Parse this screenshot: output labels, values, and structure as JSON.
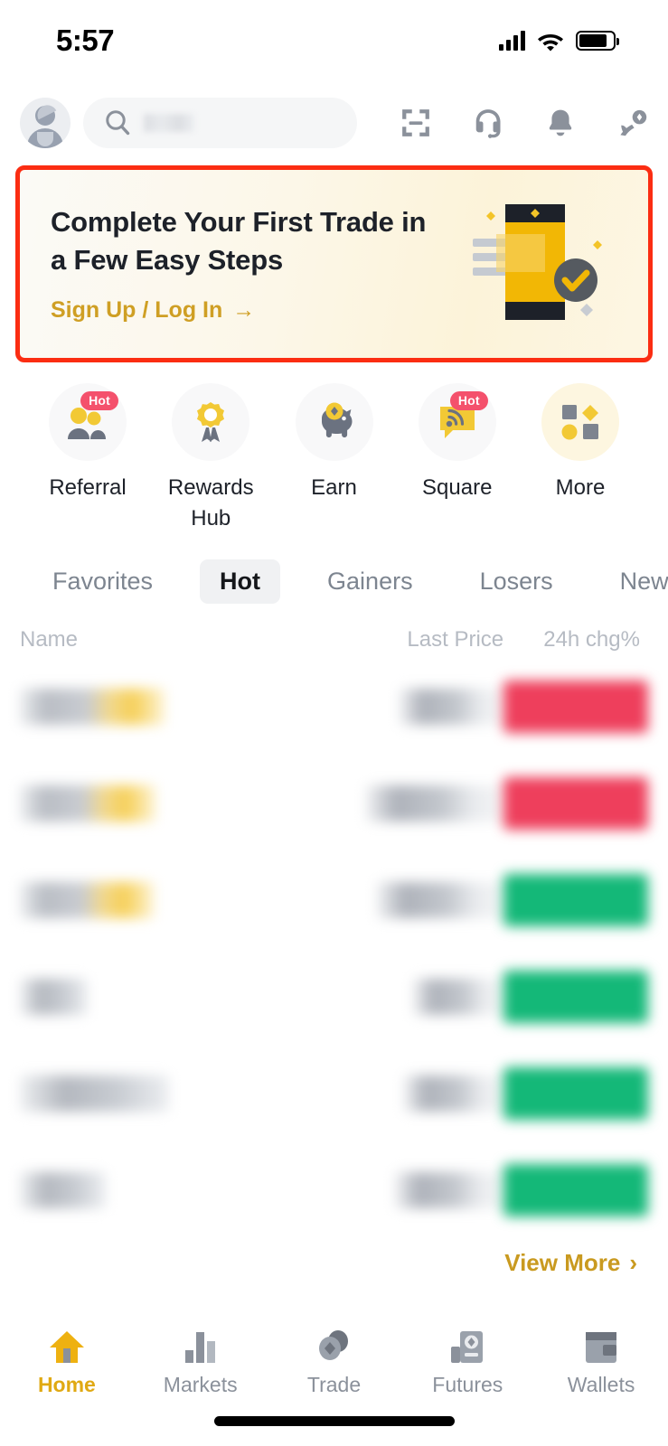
{
  "status_bar": {
    "time": "5:57",
    "signal_icon": "signal-bars-icon",
    "wifi_icon": "wifi-icon",
    "battery_icon": "battery-icon"
  },
  "header": {
    "avatar": "user-avatar",
    "search": {
      "placeholder": "",
      "icon": "search-icon"
    },
    "icons": [
      {
        "name": "qr-scan-icon",
        "label": "Scan"
      },
      {
        "name": "headset-support-icon",
        "label": "Support"
      },
      {
        "name": "bell-notification-icon",
        "label": "Notifications"
      },
      {
        "name": "hand-coin-deposit-icon",
        "label": "Deposit"
      }
    ]
  },
  "banner": {
    "title": "Complete Your First Trade in\na Few Easy Steps",
    "cta_label": "Sign Up / Log In",
    "cta_arrow": "→",
    "highlight_color": "#fb2d12",
    "accent_color": "#cf9f24",
    "illustration": "phone-checkmark-illustration"
  },
  "quick_actions": [
    {
      "label": "Referral",
      "icon": "two-people-icon",
      "badge": "Hot",
      "highlight": false
    },
    {
      "label": "Rewards\nHub",
      "icon": "award-ribbon-icon",
      "badge": "",
      "highlight": false
    },
    {
      "label": "Earn",
      "icon": "piggy-bank-icon",
      "badge": "",
      "highlight": false
    },
    {
      "label": "Square",
      "icon": "speech-bubble-rss-icon",
      "badge": "Hot",
      "highlight": false
    },
    {
      "label": "More",
      "icon": "grid-shapes-icon",
      "badge": "",
      "highlight": true
    }
  ],
  "market_tabs": [
    {
      "label": "Favorites",
      "active": false
    },
    {
      "label": "Hot",
      "active": true
    },
    {
      "label": "Gainers",
      "active": false
    },
    {
      "label": "Losers",
      "active": false
    },
    {
      "label": "New L",
      "active": false
    }
  ],
  "market_table": {
    "columns": {
      "name": "Name",
      "price": "Last Price",
      "change": "24h chg%"
    },
    "rows": [
      {
        "name": "",
        "price": "",
        "change": "",
        "direction": "down",
        "name_style": "gold"
      },
      {
        "name": "",
        "price": "",
        "change": "",
        "direction": "down",
        "name_style": "gold"
      },
      {
        "name": "",
        "price": "",
        "change": "",
        "direction": "up",
        "name_style": "gold"
      },
      {
        "name": "",
        "price": "",
        "change": "",
        "direction": "up",
        "name_style": "plain"
      },
      {
        "name": "",
        "price": "",
        "change": "",
        "direction": "up",
        "name_style": "plain"
      },
      {
        "name": "",
        "price": "",
        "change": "",
        "direction": "up",
        "name_style": "plain"
      }
    ],
    "up_color": "#14b878",
    "down_color": "#ee3f5c"
  },
  "view_more": {
    "label": "View More",
    "chevron": "›"
  },
  "bottom_nav": [
    {
      "label": "Home",
      "icon": "home-icon",
      "active": true
    },
    {
      "label": "Markets",
      "icon": "bar-chart-icon",
      "active": false
    },
    {
      "label": "Trade",
      "icon": "trade-coins-icon",
      "active": false
    },
    {
      "label": "Futures",
      "icon": "futures-icon",
      "active": false
    },
    {
      "label": "Wallets",
      "icon": "wallet-icon",
      "active": false
    }
  ]
}
